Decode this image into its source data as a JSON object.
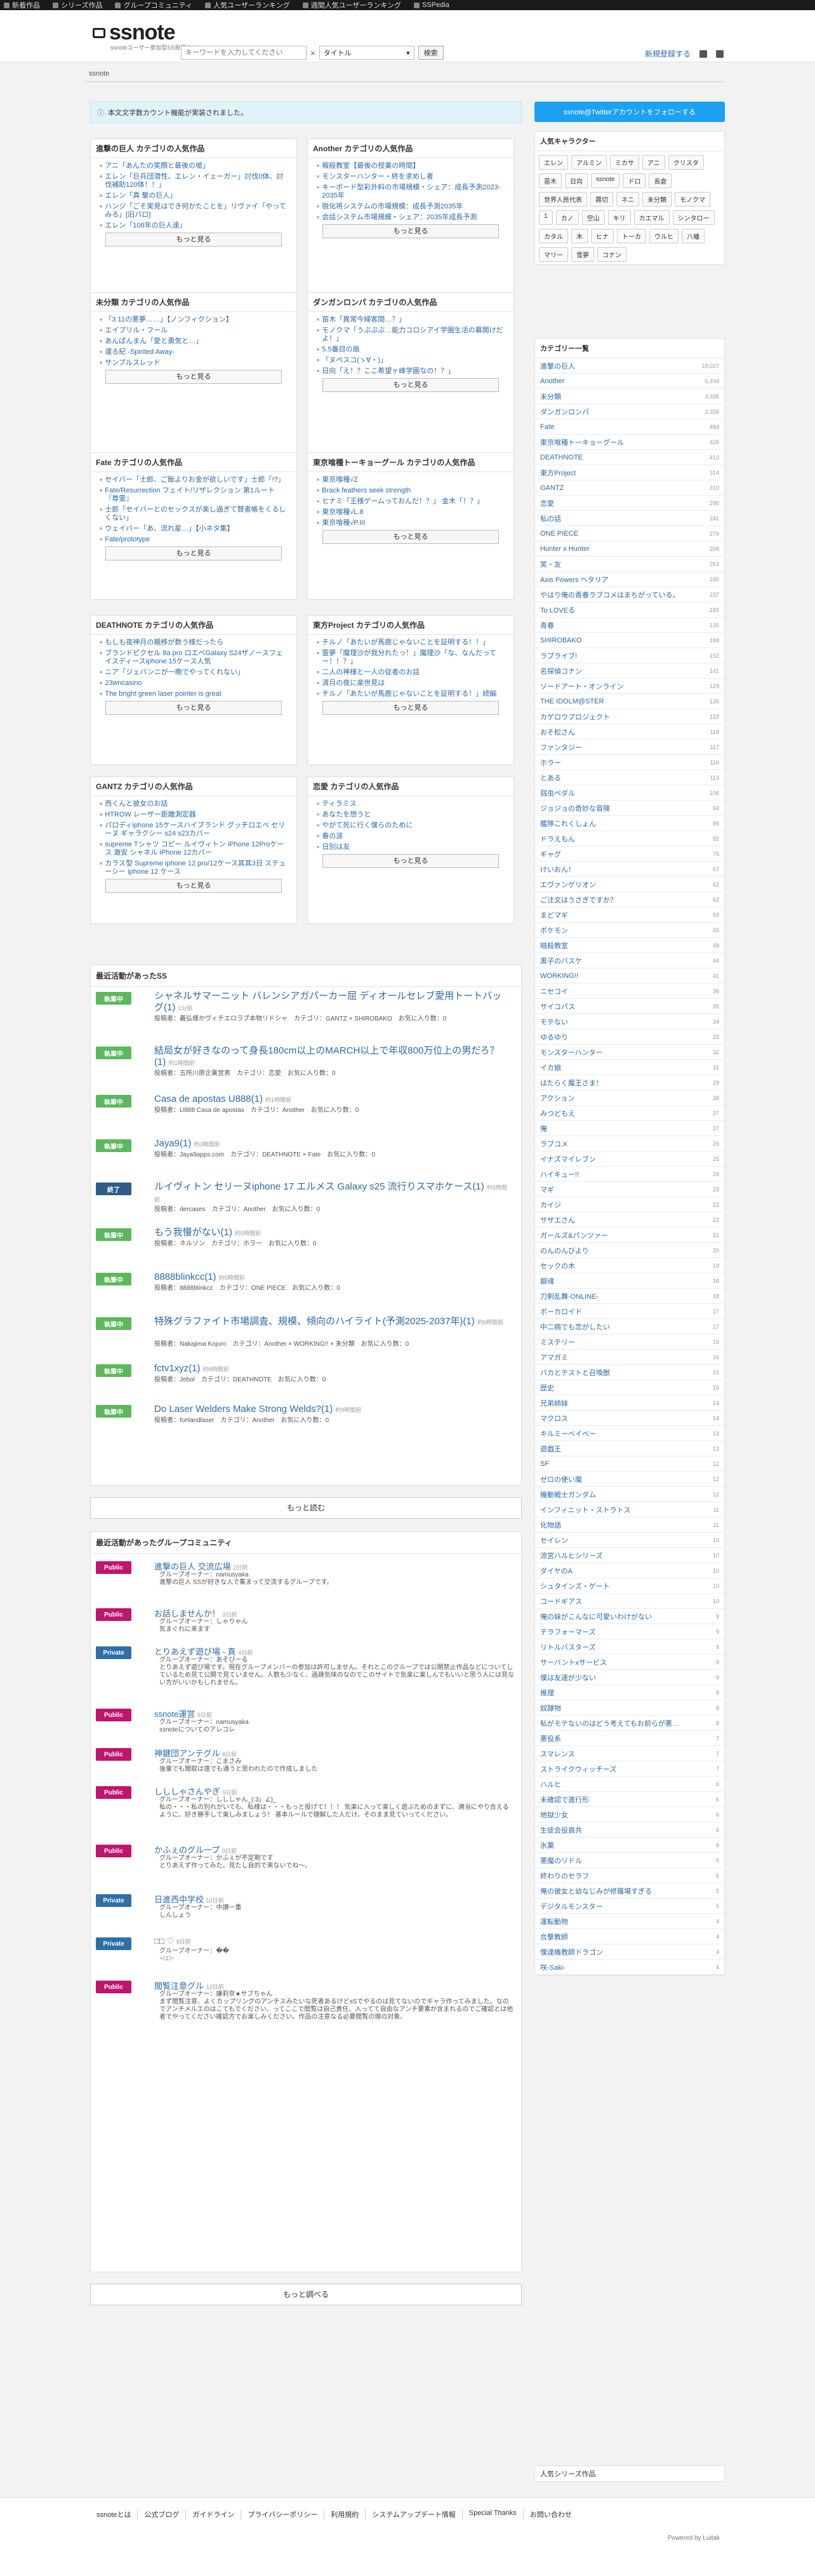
{
  "topbar": {
    "items": [
      "新着作品",
      "シリーズ作品",
      "グループコミュニティ",
      "人気ユーザーランキング",
      "週間人気ユーザーランキング",
      "SSPedia"
    ]
  },
  "header": {
    "logo": "ssnote",
    "tagline": "ssnoteユーザー参加型SS投稿サイト",
    "search_placeholder": "キーワードを入力してください",
    "search_select": "タイトル",
    "search_button": "検索",
    "register": "新規登録する"
  },
  "breadcrumb": "ssnote",
  "notice": "本文文字数カウント機能が実装されました。",
  "categories": [
    {
      "title": "進撃の巨人 カテゴリの人気作品",
      "items": [
        "アニ「あんたの笑顔と最後の嘘」",
        "エレン「巨兵団潜性、エレン・イェーガー」討伐0体、討伐補助120体！！」",
        "エレン「真 撃の巨人」",
        "ハンジ「ごそ実見はでき何かたことを」リヴァイ「やってみる」[旧パロ]",
        "エレン「108年の巨人達」"
      ],
      "more": "もっと見る"
    },
    {
      "title": "Another カテゴリの人気作品",
      "items": [
        "報殺教室【最後の授業の時間】",
        "モンスターハンター・終を求めし者",
        "キーボード型彩外料の市場規模・シェア：成長予測2023-2035年",
        "脱化将システムの市場規模：成長予測2035年",
        "会話システム市場規模・シェア：2035年成長予測"
      ],
      "more": "もっと見る"
    },
    {
      "title": "未分類 カテゴリの人気作品",
      "items": [
        "「3.11の悪夢……」【ノンフィクション】",
        "エイプリル・フール",
        "あんぱんまん「愛と勇気と…」",
        "運る紀 -Spirited Away-",
        "サンプルスレッド"
      ],
      "more": "もっと見る"
    },
    {
      "title": "ダンガンロンパ カテゴリの人気作品",
      "items": [
        "苗木「異常今婦客間…？」",
        "モノクマ「うぷぷぷ…能力コロシアイ学園生活の幕開けだよ！」",
        "5.5番目の扇",
        "「ヌペスコ(ゝ∀・)」",
        "日向「え！？ここ希望ヶ峰学園なの！？」"
      ],
      "more": "もっと見る"
    },
    {
      "title": "Fate カテゴリの人気作品",
      "items": [
        "セイバー「士郎、ご飯よりお金が欲しいです」士郎「!?」",
        "Fate/Resurrection フェイト/リザレクション 第1ルート『尊霊』",
        "士郎「セイバーとのセックスが楽し過ぎて賢者帳をくるしくない」",
        "ウェイバー「あ、流れ星…」【小ネタ集】",
        "Fate/prototype"
      ],
      "more": "もっと見る"
    },
    {
      "title": "東京喰種トーキョーグール カテゴリの人気作品",
      "items": [
        "東京喰種√Z",
        "Brack feathers seek strength",
        "ヒナミ「王様ゲームっておんだ！？」 金木「！？」",
        "東京喰種√L.8",
        "東京喰種√P.III"
      ],
      "more": "もっと見る"
    },
    {
      "title": "DEATHNOTE カテゴリの人気作品",
      "items": [
        "もしも夜神月の親移が数う様だったら",
        "ブランドピクセル 8a pro ロエベGalaxy S24ザノースフェイスディースiphone 15ケース人気",
        "ニア「ジェバンニが一晩でやってくれない」",
        "23wncasino",
        "The bright green laser pointer is great"
      ],
      "more": "もっと見る"
    },
    {
      "title": "東方Project カテゴリの人気作品",
      "items": [
        "チルノ「あたいが馬鹿じゃないことを証明する！！」",
        "霊夢「魔理沙が我分れたっ！」魔理沙「な、なんだってー！！？」",
        "二人の神様と一人の従者のお話",
        "清月の夜に楽世見は",
        "チルノ「あたいが馬鹿じゃないことを証明する！」続編"
      ],
      "more": "もっと見る"
    },
    {
      "title": "GANTZ カテゴリの人気作品",
      "items": [
        "西くんと彼女のお話",
        "HTROW レーザー距離測定器",
        "パロディiphone 15ケースハイブランド グッチロエベ セリーヌ ギャラクシー s24 s23カバー",
        "supreme Tシャツ コピー ルイヴィトン iPhone 12Proケース 激安 シャネル iPhone 12カバー",
        "カラス型 Supreme iphone 12 pro/12ケース其其3日 ステューシー iphone 12 ケース"
      ],
      "more": "もっと見る"
    },
    {
      "title": "恋愛 カテゴリの人気作品",
      "items": [
        "ティラミス",
        "あなたを想うと",
        "やがて死に行く僕らのために",
        "春の涙",
        "日別は友"
      ],
      "more": "もっと見る"
    }
  ],
  "recent_ss": {
    "title": "最近活動があったSS",
    "items": [
      {
        "status": "執筆中",
        "title": "シャネルサマーニット バレンシアガパーカー屈 ディオールセレブ愛用トートバッグ(1)",
        "time": "1分前",
        "meta": "投稿者：義弘様かヴィチエロラブ本物リドシャ　カテゴリ：GANTZ × SHIROBAKO　お気に入り数：0"
      },
      {
        "status": "執筆中",
        "title": "結局女が好きなのって身長180cm以上のMARCH以上で年収800万位上の男だろ？(1)",
        "time": "約1時間前",
        "meta": "投稿者：五所川原企業営男　カテゴリ：恋愛　お気に入り数：0"
      },
      {
        "status": "執筆中",
        "title": "Casa de apostas U888(1)",
        "time": "約1時間前",
        "meta": "投稿者：U888 Casa de apostas　カテゴリ：Another　お気に入り数：0"
      },
      {
        "status": "執筆中",
        "title": "Jaya9(1)",
        "time": "約3時間前",
        "meta": "投稿者：Jaya9apps.com　カテゴリ：DEATHNOTE × Fate　お気に入り数：0"
      },
      {
        "status": "終了",
        "title": "ルイヴィトン セリーヌiphone 17 エルメス Galaxy s25 流行りスマホケース(1)",
        "time": "約5時間前",
        "meta": "投稿者：dercases　カテゴリ：Another　お気に入り数：0"
      },
      {
        "status": "執筆中",
        "title": "もう我慢がない(1)",
        "time": "約5時間前",
        "meta": "投稿者：ネルソン　カテゴリ：ホラー　お気に入り数：0"
      },
      {
        "status": "執筆中",
        "title": "8888blinkcc(1)",
        "time": "約5時間前",
        "meta": "投稿者：8888blinkcc　カテゴリ：ONE PIECE　お気に入り数：0"
      },
      {
        "status": "執筆中",
        "title": "特殊グラファイト市場調査、規模、傾向のハイライト(予測2025-2037年)(1)",
        "time": "約6時間前",
        "meta": "投稿者：Nakajima Kojuro　カテゴリ：Another × WORKING!! × 未分類　お気に入り数：0"
      },
      {
        "status": "執筆中",
        "title": "fctv1xyz(1)",
        "time": "約8時間前",
        "meta": "投稿者：Jebol　カテゴリ：DEATHNOTE　お気に入り数：0"
      },
      {
        "status": "執筆中",
        "title": "Do Laser Welders Make Strong Welds?(1)",
        "time": "約9時間前",
        "meta": "投稿者：fonlandlaser　カテゴリ：Another　お気に入り数：0"
      }
    ],
    "more": "もっと読む"
  },
  "recent_groups": {
    "title": "最近活動があったグループコミュニティ",
    "items": [
      {
        "status": "Public",
        "name": "進撃の巨人 交流広場",
        "time": "2日前",
        "owner": "グループオーナー：namusyaka",
        "desc": "進撃の巨人 SSが好きな人で集まって交流するグループです。"
      },
      {
        "status": "Public",
        "name": "お話しませんか！",
        "time": "3日前",
        "owner": "グループオーナー：しゃりゃん",
        "desc": "気まぐれに来ます"
      },
      {
        "status": "Private",
        "name": "とりあえず遊び場 - 真",
        "time": "4日前",
        "owner": "グループオーナー：あそびーる",
        "desc": "とりあえず遊び場です。現在グループメンバーの参加は許可しません。それとこのグループでは公開禁止作品などについてしているため見て公開で見ていません。人数も少なく、過疎気味のなのでこのサイトで気楽に楽しんでもいいと思う人には見ない方がいいかもしれません。"
      },
      {
        "status": "Public",
        "name": "ssnote運営",
        "time": "6日前",
        "owner": "グループオーナー：namusyaka",
        "desc": "ssnoteについてのアレコレ"
      },
      {
        "status": "Public",
        "name": "神鍵団アンテグル",
        "time": "8日前",
        "owner": "グループオーナー：こまさみ",
        "desc": "後輩でも聞取は遠でも通うと思われたので作成しました"
      },
      {
        "status": "Public",
        "name": "しししゃさんやぎ",
        "time": "9日前",
        "owner": "グループオーナー：しししゃん_(:3」∠)_",
        "desc": "私の・・・私の別れがいても、私様は・・・もっと投げて！！！ 気楽に入って楽しく遊ぶためのまずに、適当にやり合えるように。好き勝手して楽しみましょう！ 基本ルールで理解した人だけ。そのまま見ていってください。"
      },
      {
        "status": "Public",
        "name": "かふぇのグループ",
        "time": "9日前",
        "owner": "グループオーナー：かふぇが不定期です",
        "desc": "とりあえず作ってみた。見たし自的で来ないでね〜。"
      },
      {
        "status": "Private",
        "name": "日進西中学校",
        "time": "10日前",
        "owner": "グループオーナー：中讃一重",
        "desc": "しんしょう"
      },
      {
        "status": "Private",
        "name": "□□ ♡",
        "time": "9日前",
        "owner": "グループオーナー：��",
        "desc": "~□□~"
      },
      {
        "status": "Public",
        "name": "閲覧注意グル",
        "time": "12日前",
        "owner": "グループオーナー：嫌莉奈★サブちゃん",
        "desc": "まず閲覧注意、よくカップリングのアンチスみたいな死者あるけどsSでやるのは見てないのでギャラ作ってみました。なのでアンチメルエのはこてもでください。ってここで閲覧は自己責任。入ってて自由なアンチ要素が含まれるのでご確認とは他者でやってください確認方でお楽しみください。作品の注意なる必要閲覧の理の対象。"
      }
    ],
    "more": "もっと調べる"
  },
  "sidebar": {
    "twitter": "ssnote@Twitterアカウントをフォローする",
    "popular_chars_title": "人気キャラクター",
    "popular_chars": [
      "エレン",
      "アルミン",
      "ミカサ",
      "アニ",
      "クリスタ",
      "苗木",
      "日向",
      "ssnote",
      "ドロ",
      "長倉",
      "世界人民代表",
      "霧切",
      "ネニ",
      "未分類",
      "モノクマ",
      "1",
      "カノ",
      "空山",
      "キリ",
      "カエマル",
      "シンタロー",
      "カタル",
      "木",
      "ヒナ",
      "トーカ",
      "ウルヒ",
      "八幡",
      "マリー",
      "雪夢",
      "コナン"
    ],
    "cat_title": "カテゴリー一覧",
    "cats": [
      [
        "進撃の巨人",
        "19,027"
      ],
      [
        "Another",
        "5,494"
      ],
      [
        "未分類",
        "3,336"
      ],
      [
        "ダンガンロンパ",
        "2,336"
      ],
      [
        "Fate",
        "484"
      ],
      [
        "東京喰種トーキョーグール",
        "426"
      ],
      [
        "DEATHNOTE",
        "413"
      ],
      [
        "東方Project",
        "314"
      ],
      [
        "GANTZ",
        "310"
      ],
      [
        "恋愛",
        "290"
      ],
      [
        "私の話",
        "241"
      ],
      [
        "ONE PIECE",
        "279"
      ],
      [
        "Hunter x Hunter",
        "258"
      ],
      [
        "笑・友",
        "253"
      ],
      [
        "Axis Powers ヘタリア",
        "245"
      ],
      [
        "やはり俺の青春ラブコメはまちがっている。",
        "237"
      ],
      [
        "To LOVEる",
        "183"
      ],
      [
        "青春",
        "135"
      ],
      [
        "SHIROBAKO",
        "168"
      ],
      [
        "ラブライブ!",
        "152"
      ],
      [
        "名探偵コナン",
        "141"
      ],
      [
        "ソードアート・オンライン",
        "129"
      ],
      [
        "THE IDOLM@STER",
        "126"
      ],
      [
        "カゲロウプロジェクト",
        "122"
      ],
      [
        "おそ松さん",
        "118"
      ],
      [
        "ファンタジー",
        "117"
      ],
      [
        "ホラー",
        "116"
      ],
      [
        "とある",
        "113"
      ],
      [
        "弱虫ペダル",
        "106"
      ],
      [
        "ジョジョの奇妙な冒険",
        "94"
      ],
      [
        "艦隊これくしょん",
        "86"
      ],
      [
        "ドラえもん",
        "82"
      ],
      [
        "ギャグ",
        "75"
      ],
      [
        "けいおん！",
        "67"
      ],
      [
        "エヴァンゲリオン",
        "62"
      ],
      [
        "ご注文はうさぎですか？",
        "62"
      ],
      [
        "まどマギ",
        "59"
      ],
      [
        "ポケモン",
        "55"
      ],
      [
        "暗殺教室",
        "48"
      ],
      [
        "黒子のバスケ",
        "44"
      ],
      [
        "WORKING!!",
        "41"
      ],
      [
        "ニセコイ",
        "36"
      ],
      [
        "サイコパス",
        "35"
      ],
      [
        "モテない",
        "34"
      ],
      [
        "ゆるゆり",
        "33"
      ],
      [
        "モンスターハンター",
        "32"
      ],
      [
        "イカ娘",
        "31"
      ],
      [
        "はたらく魔王さま！",
        "29"
      ],
      [
        "アクション",
        "28"
      ],
      [
        "みつどもえ",
        "27"
      ],
      [
        "俺",
        "27"
      ],
      [
        "ラブコメ",
        "26"
      ],
      [
        "イナズマイレブン",
        "25"
      ],
      [
        "ハイキュー!!",
        "24"
      ],
      [
        "マギ",
        "23"
      ],
      [
        "カイジ",
        "22"
      ],
      [
        "サザエさん",
        "22"
      ],
      [
        "ガールズ&パンツァー",
        "21"
      ],
      [
        "のんのんびより",
        "20"
      ],
      [
        "セックの木",
        "19"
      ],
      [
        "銀魂",
        "18"
      ],
      [
        "刀剣乱舞-ONLINE-",
        "18"
      ],
      [
        "ボーカロイド",
        "17"
      ],
      [
        "中二病でも恋がしたい",
        "17"
      ],
      [
        "ミステリー",
        "16"
      ],
      [
        "アマガミ",
        "16"
      ],
      [
        "バカとテストと召喚獣",
        "15"
      ],
      [
        "歴史",
        "15"
      ],
      [
        "兄弟姉妹",
        "14"
      ],
      [
        "マクロス",
        "14"
      ],
      [
        "キルミーベイベー",
        "13"
      ],
      [
        "遊戯王",
        "13"
      ],
      [
        "SF",
        "12"
      ],
      [
        "ゼロの使い魔",
        "12"
      ],
      [
        "機動戦士ガンダム",
        "12"
      ],
      [
        "インフィニット・ストラトス",
        "11"
      ],
      [
        "化物語",
        "11"
      ],
      [
        "セイレン",
        "10"
      ],
      [
        "涼宮ハルヒシリーズ",
        "10"
      ],
      [
        "ダイヤのA",
        "10"
      ],
      [
        "シュタインズ・ゲート",
        "10"
      ],
      [
        "コードギアス",
        "10"
      ],
      [
        "俺の妹がこんなに可愛いわけがない",
        "9"
      ],
      [
        "テラフォーマーズ",
        "9"
      ],
      [
        "リトルバスターズ",
        "9"
      ],
      [
        "サーバントxサービス",
        "9"
      ],
      [
        "僕は友達が少ない",
        "9"
      ],
      [
        "推理",
        "8"
      ],
      [
        "奴隷物",
        "8"
      ],
      [
        "私がモテないのはどう考えてもお前らが悪い!",
        "8"
      ],
      [
        "悪役系",
        "7"
      ],
      [
        "スマレンス",
        "7"
      ],
      [
        "ストライクウィッチーズ",
        "7"
      ],
      [
        "ハルヒ",
        "6"
      ],
      [
        "未確認で進行形",
        "6"
      ],
      [
        "地獄少女",
        "6"
      ],
      [
        "生徒会役員共",
        "6"
      ],
      [
        "氷菓",
        "6"
      ],
      [
        "悪魔のリドル",
        "5"
      ],
      [
        "終わりのセラフ",
        "5"
      ],
      [
        "俺の彼女と幼なじみが修羅場すぎる",
        "5"
      ],
      [
        "デジタルモンスター",
        "5"
      ],
      [
        "運転動物",
        "4"
      ],
      [
        "合撃教師",
        "4"
      ],
      [
        "僕達機教師ドラゴン",
        "4"
      ],
      [
        "咲-Saki-",
        "4"
      ]
    ],
    "series_link": "人気シリーズ作品"
  },
  "footer": {
    "links": [
      "ssnoteとは",
      "公式ブログ",
      "ガイドライン",
      "プライバシーポリシー",
      "利用規約",
      "システムアップデート情報",
      "Special Thanks",
      "お問い合わせ"
    ],
    "powered": "Powered by Luitak"
  },
  "colors": {
    "working": "#5cb85c",
    "finished": "#2f5d88",
    "public": "#c0156e",
    "private": "#2f6fa8",
    "twitter": "#1da1f2"
  }
}
